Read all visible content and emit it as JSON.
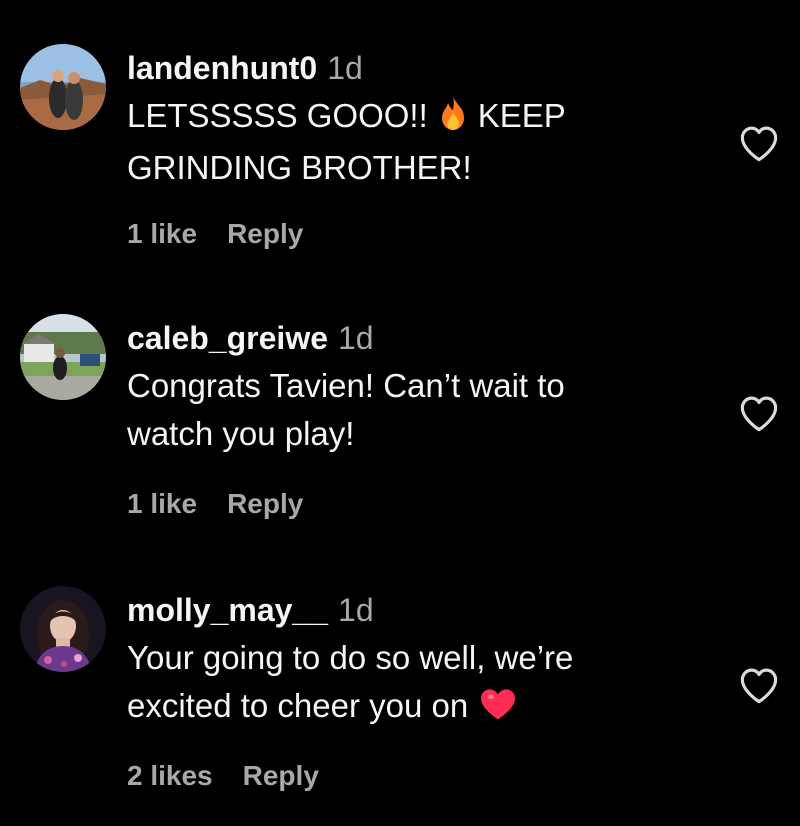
{
  "comments": [
    {
      "username": "landenhunt0",
      "time": "1d",
      "text_line1": "LETSSSSS GOOO!!",
      "text_line1_after": "KEEP",
      "text_line2": "GRINDING BROTHER!",
      "emoji": "fire-icon",
      "likes": "1 like",
      "reply": "Reply"
    },
    {
      "username": "caleb_greiwe",
      "time": "1d",
      "text_line1": "Congrats Tavien! Can’t wait to",
      "text_line2": "watch you play!",
      "likes": "1 like",
      "reply": "Reply"
    },
    {
      "username": "molly_may__",
      "time": "1d",
      "text_line1": "Your going to do so well, we’re",
      "text_line2": "excited to cheer you on",
      "emoji": "red-heart-icon",
      "likes": "2 likes",
      "reply": "Reply"
    }
  ],
  "colors": {
    "background": "#000000",
    "primary_text": "#f5f5f5",
    "secondary_text": "#a8a8a8",
    "heart_emoji": "#ff2d55",
    "fire_emoji": "#ff7a1a"
  }
}
